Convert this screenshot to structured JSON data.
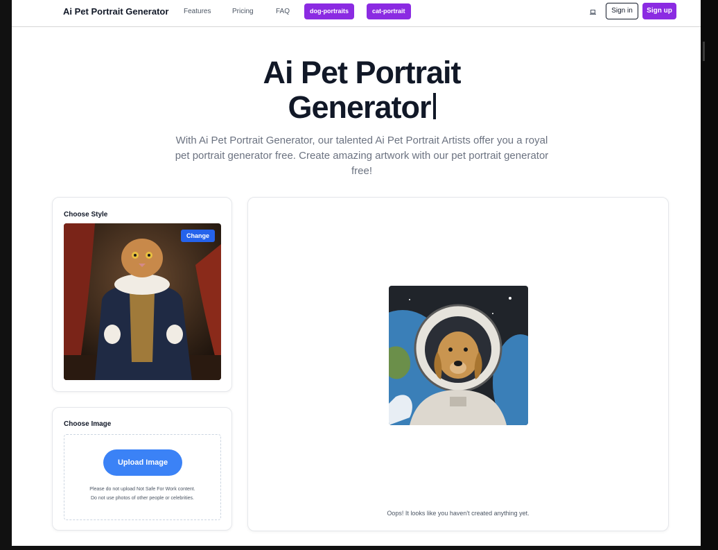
{
  "nav": {
    "brand": "Ai Pet Portrait Generator",
    "links": [
      "Features",
      "Pricing",
      "FAQ"
    ],
    "pills": [
      "dog-portraits",
      "cat-portrait"
    ],
    "device_icon": "laptop-icon",
    "sign_in": "Sign in",
    "sign_up": "Sign up"
  },
  "hero": {
    "title_line1": "Ai Pet Portrait",
    "title_line2": "Generator",
    "subtitle": "With Ai Pet Portrait Generator, our talented Ai Pet Portrait Artists offer you a royal pet portrait generator free. Create amazing artwork with our pet portrait generator free!"
  },
  "style_panel": {
    "title": "Choose Style",
    "change_button": "Change"
  },
  "image_panel": {
    "title": "Choose Image",
    "upload_button": "Upload Image",
    "note_line1": "Please do not upload Not Safe For Work content.",
    "note_line2": "Do not use photos of other people or celebrities."
  },
  "result_panel": {
    "empty_message": "Oops! It looks like you haven't created anything yet."
  },
  "colors": {
    "accent_purple": "#8b2be2",
    "button_blue": "#2563eb",
    "upload_blue": "#3b82f6",
    "text_dark": "#111827",
    "text_muted": "#6b7280"
  }
}
